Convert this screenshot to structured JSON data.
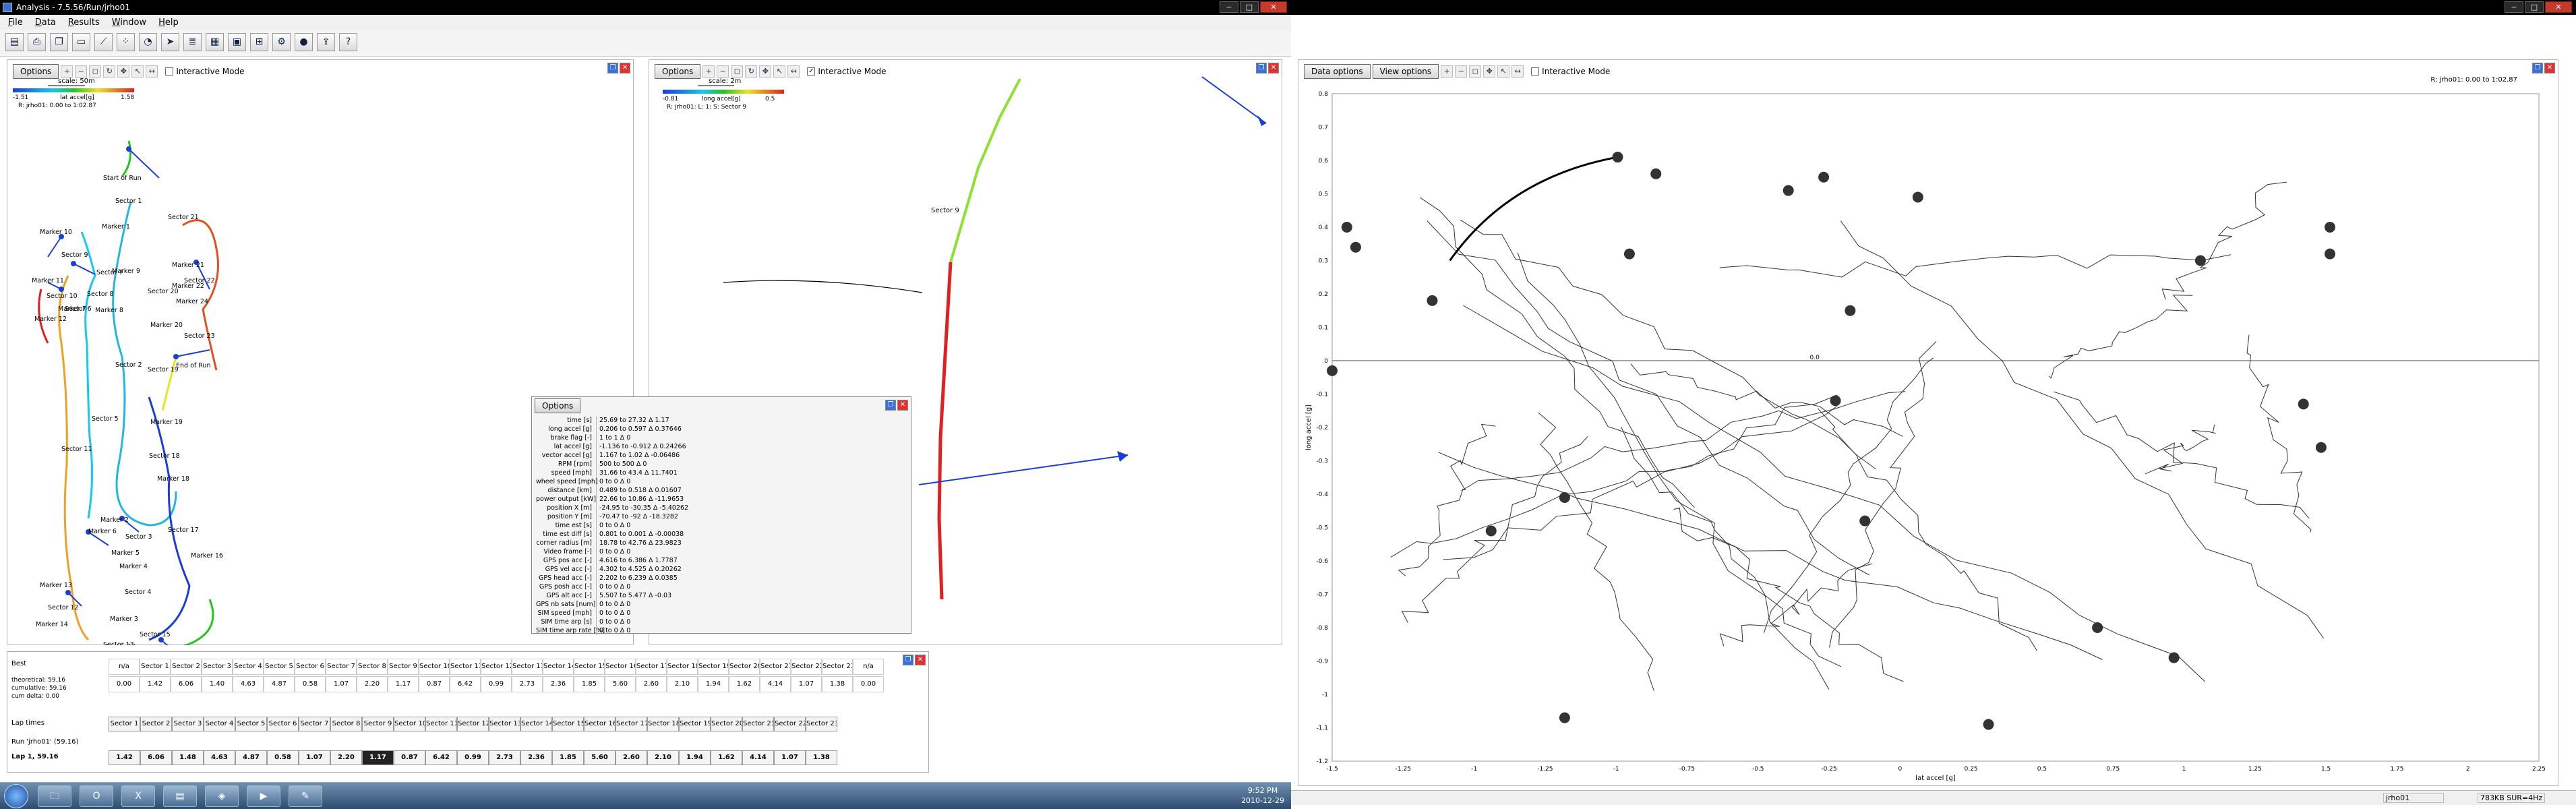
{
  "window": {
    "title": "Analysis - 7.5.56/Run/jrho01"
  },
  "menu": [
    "File",
    "Data",
    "Results",
    "Window",
    "Help"
  ],
  "toolbar": [
    "open-icon",
    "print-icon",
    "copy-icon",
    "page-icon",
    "chart-icon",
    "scatter-icon",
    "gauge-icon",
    "run-icon",
    "report-icon",
    "grid-icon",
    "image-icon",
    "table-icon",
    "settings-icon",
    "record-icon",
    "export-icon",
    "help-icon"
  ],
  "left_panel": {
    "options_label": "Options",
    "interactive_mode": "Interactive Mode",
    "scale": "scale: 50m",
    "colorbar": {
      "min": "-1.51",
      "label": "lat accel",
      "unit": "[g]",
      "max": "1.58"
    },
    "run_info": "R: jrho01: 0.00 to 1:02.87",
    "labels": [
      {
        "t": "Start of Run"
      },
      {
        "t": "Sector 1"
      },
      {
        "t": "Marker 1"
      },
      {
        "t": "Sector 2"
      },
      {
        "t": "Marker 10"
      },
      {
        "t": "Sector 9"
      },
      {
        "t": "Marker 9"
      },
      {
        "t": "Sector 8"
      },
      {
        "t": "Sector 7"
      },
      {
        "t": "Marker 8"
      },
      {
        "t": "Marker 11"
      },
      {
        "t": "Sector 10"
      },
      {
        "t": "Sector 6"
      },
      {
        "t": "Marker 12"
      },
      {
        "t": "Marker 7"
      },
      {
        "t": "Sector 5"
      },
      {
        "t": "Sector 11"
      },
      {
        "t": "Sector 21"
      },
      {
        "t": "Marker 21"
      },
      {
        "t": "Marker 22"
      },
      {
        "t": "Sector 22"
      },
      {
        "t": "Sector 20"
      },
      {
        "t": "Marker 20"
      },
      {
        "t": "Marker 24"
      },
      {
        "t": "Sector 23"
      },
      {
        "t": "Sector 19"
      },
      {
        "t": "End of Run"
      },
      {
        "t": "Marker 19"
      },
      {
        "t": "Sector 18"
      },
      {
        "t": "Marker 18"
      },
      {
        "t": "Sector 17"
      },
      {
        "t": "Marker 2"
      },
      {
        "t": "Marker 6"
      },
      {
        "t": "Sector 3"
      },
      {
        "t": "Marker 5"
      },
      {
        "t": "Marker 4"
      },
      {
        "t": "Sector 4"
      },
      {
        "t": "Marker 3"
      },
      {
        "t": "Marker 13"
      },
      {
        "t": "Sector 12"
      },
      {
        "t": "Marker 14"
      },
      {
        "t": "Marker 15"
      },
      {
        "t": "Sector 13"
      },
      {
        "t": "Sector 14"
      },
      {
        "t": "Marker 16"
      },
      {
        "t": "Sector 15"
      },
      {
        "t": "Marker 17"
      },
      {
        "t": "Sector 16"
      },
      {
        "t": "Marker 16"
      }
    ]
  },
  "middle_panel": {
    "options_label": "Options",
    "interactive_mode": "Interactive Mode",
    "scale": "scale: 2m",
    "colorbar": {
      "min": "-0.81",
      "label": "long accel",
      "unit": "[g]",
      "max": "0.5"
    },
    "run_info": "R: jrho01: L: 1: S: Sector 9",
    "sector_label": "Sector 9"
  },
  "info_panel": {
    "options_label": "Options",
    "rows": [
      {
        "label": "time [s]",
        "value": "25.69 to 27.32  Δ 1.17"
      },
      {
        "label": "long accel [g]",
        "value": "0.206 to 0.597  Δ 0.37646"
      },
      {
        "label": "brake flag [-]",
        "value": "1 to 1  Δ 0"
      },
      {
        "label": "lat accel [g]",
        "value": "-1.136 to -0.912  Δ 0.24266"
      },
      {
        "label": "vector accel [g]",
        "value": "1.167 to 1.02  Δ -0.06486"
      },
      {
        "label": "RPM [rpm]",
        "value": "500 to 500  Δ 0"
      },
      {
        "label": "speed [mph]",
        "value": "31.66 to 43.4  Δ 11.7401"
      },
      {
        "label": "wheel speed [mph]",
        "value": "0 to 0  Δ 0"
      },
      {
        "label": "distance [km]",
        "value": "0.489 to 0.518  Δ 0.01607"
      },
      {
        "label": "power output [kW]",
        "value": "22.66 to 10.86  Δ -11.9653"
      },
      {
        "label": "position X [m]",
        "value": "-24.95 to -30.35  Δ -5.40262"
      },
      {
        "label": "position Y [m]",
        "value": "-70.47 to -92  Δ -18.3282"
      },
      {
        "label": "time est [s]",
        "value": "0 to 0  Δ 0"
      },
      {
        "label": "time est diff [s]",
        "value": "0.801 to 0.001  Δ -0.00038"
      },
      {
        "label": "corner radius [m]",
        "value": "18.78 to 42.76  Δ 23.9823"
      },
      {
        "label": "Video frame [-]",
        "value": "0 to 0  Δ 0"
      },
      {
        "label": "GPS pos acc [-]",
        "value": "4.616 to 6.386  Δ 1.7787"
      },
      {
        "label": "GPS vel acc [-]",
        "value": "4.302 to 4.525  Δ 0.20262"
      },
      {
        "label": "GPS head acc [-]",
        "value": "2.202 to 6.239  Δ 0.0385"
      },
      {
        "label": "GPS posh acc [-]",
        "value": "0 to 0  Δ 0"
      },
      {
        "label": "GPS alt acc [-]",
        "value": "5.507 to 5.477  Δ -0.03"
      },
      {
        "label": "GPS nb sats [num]",
        "value": "0 to 0  Δ 0"
      },
      {
        "label": "SIM speed [mph]",
        "value": "0 to 0  Δ 0"
      },
      {
        "label": "SIM time arp [s]",
        "value": "0 to 0  Δ 0"
      },
      {
        "label": "SIM time arp rate [%]",
        "value": "0 to 0  Δ 0"
      }
    ]
  },
  "sector_table": {
    "row_label_header": "Best",
    "row_labels": [
      "theoretical: 59.16",
      "cumulative: 59.16",
      "cum delta: 0.00"
    ],
    "headers": [
      "n/a",
      "Sector 1",
      "Sector 2",
      "Sector 3",
      "Sector 4",
      "Sector 5",
      "Sector 6",
      "Sector 7",
      "Sector 8",
      "Sector 9",
      "Sector 10",
      "Sector 11",
      "Sector 12",
      "Sector 13",
      "Sector 14",
      "Sector 15",
      "Sector 16",
      "Sector 17",
      "Sector 18",
      "Sector 19",
      "Sector 20",
      "Sector 21",
      "Sector 22",
      "Sector 23",
      "n/a"
    ],
    "values": [
      "0.00",
      "1.42",
      "6.06",
      "1.40",
      "4.63",
      "4.87",
      "0.58",
      "1.07",
      "2.20",
      "1.17",
      "0.87",
      "6.42",
      "0.99",
      "2.73",
      "2.36",
      "1.85",
      "5.60",
      "2.60",
      "2.10",
      "1.94",
      "1.62",
      "4.14",
      "1.07",
      "1.38",
      "0.00"
    ],
    "lap_title": "Lap times",
    "run_label": "Run 'jrho01' (59.16)",
    "lap_label": "Lap 1, 59.16",
    "lap_headers": [
      "Sector 1",
      "Sector 2",
      "Sector 3",
      "Sector 4",
      "Sector 5",
      "Sector 6",
      "Sector 7",
      "Sector 8",
      "Sector 9",
      "Sector 10",
      "Sector 11",
      "Sector 12",
      "Sector 13",
      "Sector 14",
      "Sector 15",
      "Sector 16",
      "Sector 17",
      "Sector 18",
      "Sector 19",
      "Sector 20",
      "Sector 21",
      "Sector 22",
      "Sector 23"
    ],
    "lap_values": [
      "1.42",
      "6.06",
      "1.48",
      "4.63",
      "4.87",
      "0.58",
      "1.07",
      "2.20",
      "1.17",
      "0.87",
      "6.42",
      "0.99",
      "2.73",
      "2.36",
      "1.85",
      "5.60",
      "2.60",
      "2.10",
      "1.94",
      "1.62",
      "4.14",
      "1.07",
      "1.38"
    ],
    "selected_lap_index": 8
  },
  "right_panel": {
    "data_options": "Data options",
    "view_options": "View options",
    "interactive_mode": "Interactive Mode",
    "run_info": "R: jrho01: 0.00 to 1:02.87",
    "center_label": "0.0",
    "status_left": "jrho01",
    "status_right": "783KB SUR=4Hz"
  },
  "chart_data": {
    "type": "scatter",
    "title": "",
    "xlabel": "lat accel [g]",
    "ylabel": "long accel [g]",
    "xlim": [
      -1.6,
      2.5
    ],
    "ylim": [
      -1.2,
      0.8
    ],
    "x_ticks": [
      "-1.5",
      "-1.25",
      "-1",
      "-1.25",
      "-1",
      "-0.75",
      "-0.5",
      "-0.25",
      "0",
      "0.25",
      "0.5",
      "0.75",
      "1",
      "1.25",
      "1.5",
      "1.75",
      "2",
      "2.25"
    ],
    "y_ticks": [
      "0.8",
      "0.7",
      "0.6",
      "0.5",
      "0.4",
      "0.3",
      "0.2",
      "0.1",
      "0",
      "-0.1",
      "-0.2",
      "-0.3",
      "-0.4",
      "-0.5",
      "-0.6",
      "-0.7",
      "-0.8",
      "-0.9",
      "-1",
      "-1.1",
      "-1.2"
    ],
    "markers": [
      {
        "x": -0.63,
        "y": 0.61
      },
      {
        "x": -0.5,
        "y": 0.56
      },
      {
        "x": 0.07,
        "y": 0.55
      },
      {
        "x": 0.39,
        "y": 0.49
      },
      {
        "x": -0.05,
        "y": 0.51
      },
      {
        "x": -1.55,
        "y": 0.4
      },
      {
        "x": -1.52,
        "y": 0.34
      },
      {
        "x": -1.26,
        "y": 0.18
      },
      {
        "x": -0.59,
        "y": 0.32
      },
      {
        "x": 0.16,
        "y": 0.15
      },
      {
        "x": 1.35,
        "y": 0.3
      },
      {
        "x": 1.79,
        "y": 0.4
      },
      {
        "x": 1.79,
        "y": 0.32
      },
      {
        "x": -1.6,
        "y": -0.03
      },
      {
        "x": 0.11,
        "y": -0.12
      },
      {
        "x": 1.7,
        "y": -0.13
      },
      {
        "x": 1.76,
        "y": -0.26
      },
      {
        "x": -0.81,
        "y": -0.41
      },
      {
        "x": 0.21,
        "y": -0.48
      },
      {
        "x": -1.06,
        "y": -0.51
      },
      {
        "x": 1.0,
        "y": -0.8
      },
      {
        "x": 1.26,
        "y": -0.89
      },
      {
        "x": -0.81,
        "y": -1.07
      },
      {
        "x": 0.63,
        "y": -1.09
      }
    ]
  },
  "taskbar": {
    "clock_time": "9:52 PM",
    "clock_date": "2010-12-29",
    "start": "Start"
  },
  "colors": {
    "brand": "#3a6fd8",
    "close": "#c43b2b",
    "track_low": "#1a3fd6",
    "track_high": "#e02020"
  }
}
